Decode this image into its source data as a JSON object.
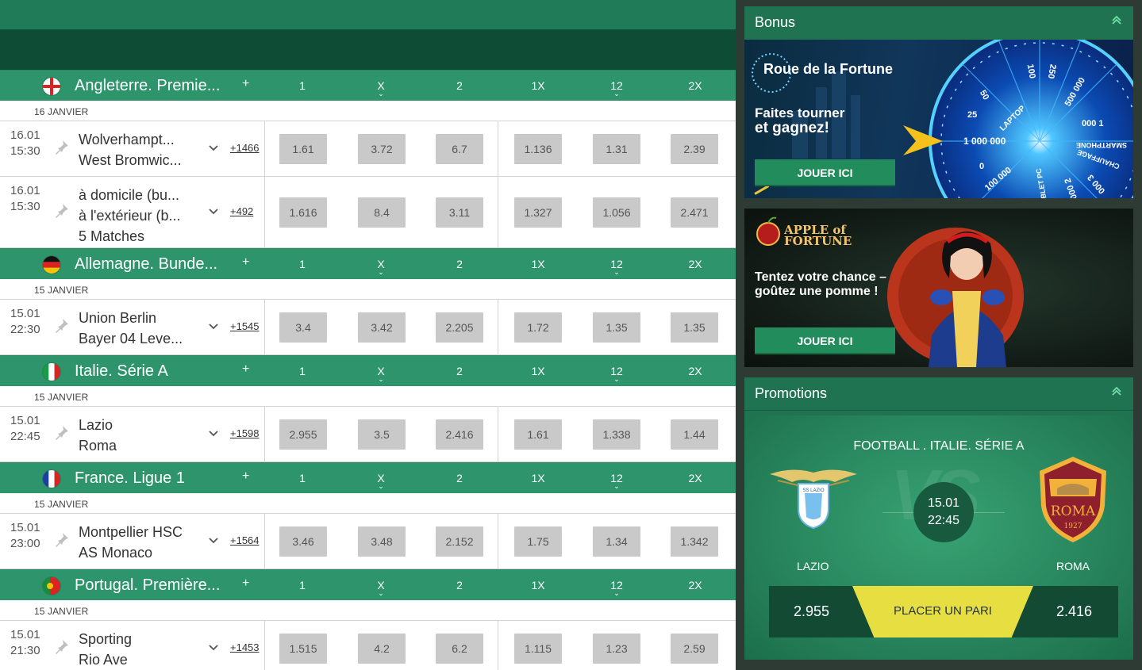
{
  "odds_headers": [
    "1",
    "X",
    "2",
    "1X",
    "12",
    "2X"
  ],
  "sections": [
    {
      "league": "Angleterre. Premie...",
      "flag": "england",
      "plus": "+",
      "date": "16 JANVIER",
      "matches": [
        {
          "date": "16.01",
          "time": "15:30",
          "teams": [
            "Wolverhampt...",
            "West Bromwic..."
          ],
          "more": "+1466",
          "odds": [
            "1.61",
            "3.72",
            "6.7",
            "1.136",
            "1.31",
            "2.39"
          ]
        },
        {
          "date": "16.01",
          "time": "15:30",
          "teams": [
            "à domicile (bu...",
            "à l'extérieur (b...",
            "5 Matches"
          ],
          "more": "+492",
          "odds": [
            "1.616",
            "8.4",
            "3.11",
            "1.327",
            "1.056",
            "2.471"
          ]
        }
      ]
    },
    {
      "league": "Allemagne. Bunde...",
      "flag": "germany",
      "plus": "+",
      "date": "15 JANVIER",
      "matches": [
        {
          "date": "15.01",
          "time": "22:30",
          "teams": [
            "Union Berlin",
            "Bayer 04 Leve..."
          ],
          "more": "+1545",
          "odds": [
            "3.4",
            "3.42",
            "2.205",
            "1.72",
            "1.35",
            "1.35"
          ]
        }
      ]
    },
    {
      "league": "Italie. Série A",
      "flag": "italy",
      "plus": "+",
      "date": "15 JANVIER",
      "matches": [
        {
          "date": "15.01",
          "time": "22:45",
          "teams": [
            "Lazio",
            "Roma"
          ],
          "more": "+1598",
          "odds": [
            "2.955",
            "3.5",
            "2.416",
            "1.61",
            "1.338",
            "1.44"
          ]
        }
      ]
    },
    {
      "league": "France. Ligue 1",
      "flag": "france",
      "plus": "+",
      "date": "15 JANVIER",
      "matches": [
        {
          "date": "15.01",
          "time": "23:00",
          "teams": [
            "Montpellier HSC",
            "AS Monaco"
          ],
          "more": "+1564",
          "odds": [
            "3.46",
            "3.48",
            "2.152",
            "1.75",
            "1.34",
            "1.342"
          ]
        }
      ]
    },
    {
      "league": "Portugal. Première...",
      "flag": "portugal",
      "plus": "+",
      "date": "15 JANVIER",
      "matches": [
        {
          "date": "15.01",
          "time": "21:30",
          "teams": [
            "Sporting",
            "Rio Ave"
          ],
          "more": "+1453",
          "odds": [
            "1.515",
            "4.2",
            "6.2",
            "1.115",
            "1.23",
            "2.59"
          ]
        }
      ]
    }
  ],
  "bonus": {
    "title": "Bonus",
    "banner1": {
      "title": "Roue de la Fortune",
      "line1": "Faites tourner",
      "line2": "et gagnez!",
      "button": "JOUER ICI",
      "wheel_values": [
        "1 000 000",
        "500 000",
        "250",
        "100",
        "50",
        "25",
        "0",
        "100 000",
        "000 1",
        "000 3",
        "000 2"
      ],
      "wheel_words": [
        "LAPTOP",
        "SMARTPHONE",
        "CHAUFFAGE",
        "TABLET PC"
      ]
    },
    "banner2": {
      "logo_line1": "APPLE of",
      "logo_line2": "FORTUNE",
      "line1": "Tentez votre chance –",
      "line2": "goûtez une pomme !",
      "button": "JOUER ICI"
    }
  },
  "promotions": {
    "title": "Promotions",
    "event": "FOOTBALL . ITALIE. SÉRIE A",
    "vs": "VS",
    "date": "15.01",
    "time": "22:45",
    "team1": "LAZIO",
    "team2": "ROMA",
    "team1_badge": "SS LAZIO",
    "team2_badge": "ROMA",
    "team2_year": "1927",
    "odd1": "2.955",
    "odd2": "2.416",
    "cta": "PLACER UN PARI"
  }
}
